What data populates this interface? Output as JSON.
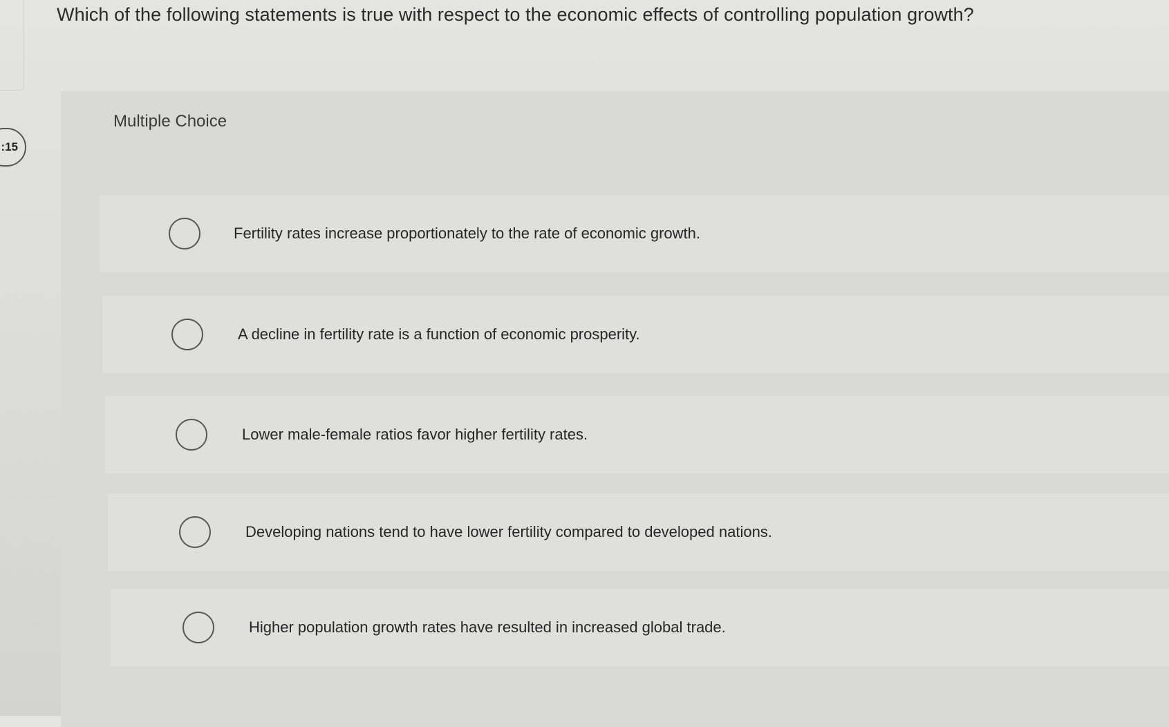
{
  "question": {
    "number_label": ":15",
    "text": "Which of the following statements is true with respect to the economic effects of controlling population growth?"
  },
  "panel": {
    "title": "Multiple Choice"
  },
  "options": [
    {
      "label": "Fertility rates increase proportionately to the rate of economic growth.",
      "selected": false
    },
    {
      "label": "A decline in fertility rate is a function of economic prosperity.",
      "selected": false
    },
    {
      "label": "Lower male-female ratios favor higher fertility rates.",
      "selected": false
    },
    {
      "label": "Developing nations tend to have lower fertility compared to developed nations.",
      "selected": false
    },
    {
      "label": "Higher population growth rates have resulted in increased global trade.",
      "selected": false
    }
  ]
}
